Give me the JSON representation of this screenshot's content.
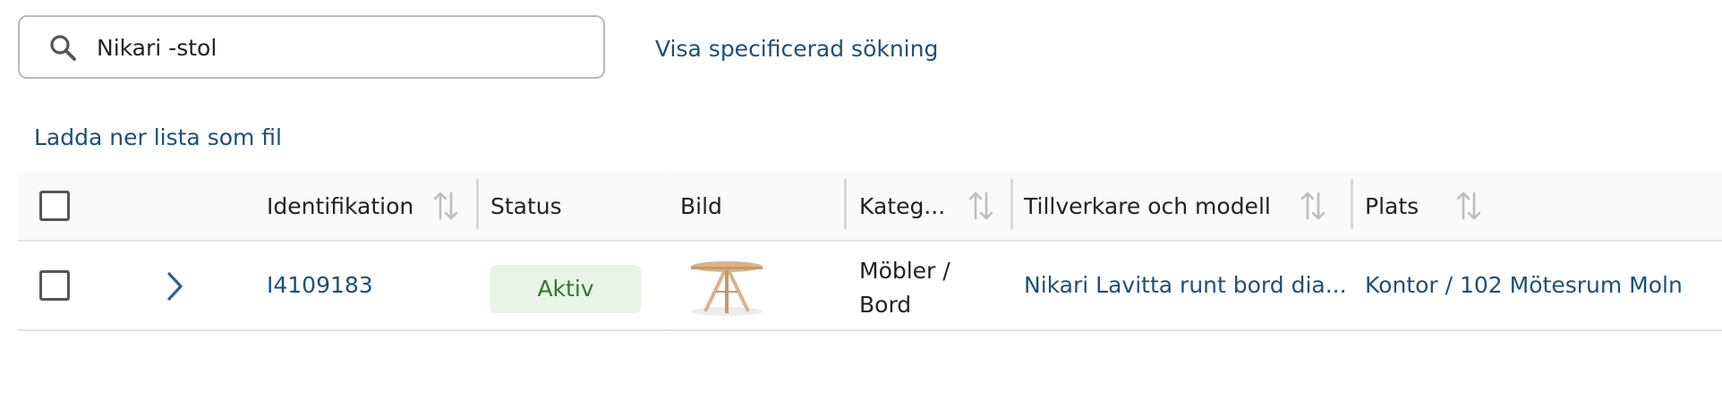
{
  "search": {
    "value": "Nikari -stol",
    "advanced_link": "Visa specificerad sökning"
  },
  "download_link": "Ladda ner lista som fil",
  "table": {
    "headers": {
      "identification": "Identifikation",
      "status": "Status",
      "image": "Bild",
      "category": "Kateg...",
      "manufacturer_model": "Tillverkare och modell",
      "location": "Plats"
    },
    "rows": [
      {
        "id": "I4109183",
        "status": "Aktiv",
        "category_line1": "Möbler /",
        "category_line2": "Bord",
        "manufacturer_model": "Nikari Lavitta runt bord dia...",
        "location": "Kontor / 102 Mötesrum Moln"
      }
    ]
  },
  "colors": {
    "link": "#1d5077",
    "status_active_bg": "#e7f4e6",
    "status_active_text": "#2f7a2b",
    "header_bg": "#fafafa"
  }
}
